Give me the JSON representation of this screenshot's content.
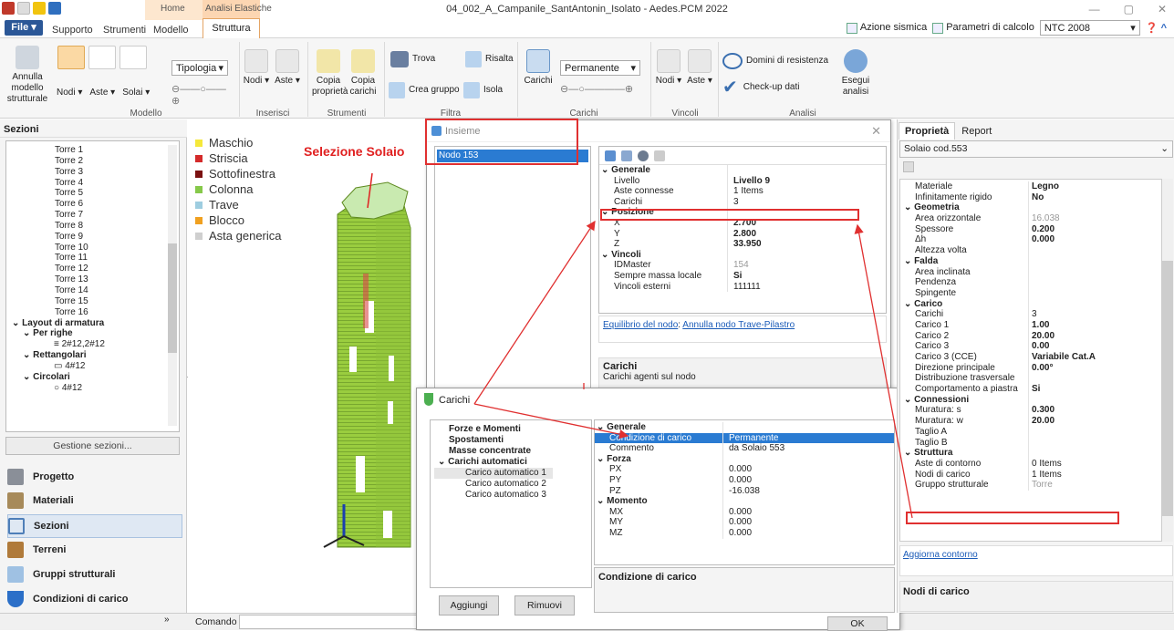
{
  "window": {
    "title": "04_002_A_Campanile_SantAntonin_Isolato - Aedes.PCM 2022"
  },
  "menu": {
    "file": "File",
    "tabs": [
      "Supporto",
      "Strumenti",
      "Modello"
    ],
    "context_home": "Home",
    "context_analisi": "Analisi Elastiche",
    "struttura": "Struttura",
    "azione_sismica": "Azione sismica",
    "parametri_calcolo": "Parametri di calcolo",
    "ntc": "NTC 2008"
  },
  "ribbon": {
    "annulla_modello": "Annulla modello strutturale",
    "nodi": "Nodi",
    "aste": "Aste",
    "solai": "Solai",
    "tipologia": "Tipologia",
    "group_modello": "Modello",
    "ins_nodi": "Nodi",
    "ins_aste": "Aste",
    "group_inserisci": "Inserisci",
    "copia_proprieta": "Copia proprietà",
    "copia_carichi": "Copia carichi",
    "group_strumenti": "Strumenti",
    "trova": "Trova",
    "risalta": "Risalta",
    "crea_gruppo": "Crea gruppo",
    "isola": "Isola",
    "group_filtra": "Filtra",
    "carichi": "Carichi",
    "permanente": "Permanente",
    "group_carichi": "Carichi",
    "vin_nodi": "Nodi",
    "vin_aste": "Aste",
    "group_vincoli": "Vincoli",
    "domini": "Domini di resistenza",
    "checkup": "Check-up dati",
    "esegui": "Esegui analisi",
    "group_analisi": "Analisi"
  },
  "left": {
    "header": "Sezioni",
    "torri": [
      "Torre 1",
      "Torre 2",
      "Torre 3",
      "Torre 4",
      "Torre 5",
      "Torre 6",
      "Torre 7",
      "Torre 8",
      "Torre 9",
      "Torre 10",
      "Torre 11",
      "Torre 12",
      "Torre 13",
      "Torre 14",
      "Torre 15",
      "Torre 16"
    ],
    "layout": "Layout di armatura",
    "per_righe": "Per righe",
    "per_righe_val": "≡ 2#12,2#12",
    "rettangolari": "Rettangolari",
    "rett_val": "▭ 4#12",
    "circolari": "Circolari",
    "circ_val": "○ 4#12",
    "gestione": "Gestione sezioni...",
    "nav": [
      "Progetto",
      "Materiali",
      "Sezioni",
      "Terreni",
      "Gruppi strutturali",
      "Condizioni di carico"
    ]
  },
  "command": {
    "label": "Comando"
  },
  "legend": [
    {
      "label": "Maschio",
      "color": "#f5e83a"
    },
    {
      "label": "Striscia",
      "color": "#d42a2a"
    },
    {
      "label": "Sottofinestra",
      "color": "#7a1010"
    },
    {
      "label": "Colonna",
      "color": "#86c94a"
    },
    {
      "label": "Trave",
      "color": "#9ecde0"
    },
    {
      "label": "Blocco",
      "color": "#f0a020"
    },
    {
      "label": "Asta generica",
      "color": "#cfcfcf"
    }
  ],
  "annotation": "Selezione Solaio",
  "insieme": {
    "title": "Insieme",
    "nodo": "Nodo 153",
    "rows": [
      {
        "k": "Generale",
        "cat": true
      },
      {
        "k": "Livello",
        "v": "Livello 9",
        "b": true
      },
      {
        "k": "Aste connesse",
        "v": "1 Items"
      },
      {
        "k": "Carichi",
        "v": "3"
      },
      {
        "k": "Posizione",
        "cat": true
      },
      {
        "k": "X",
        "v": "2.700",
        "b": true
      },
      {
        "k": "Y",
        "v": "2.800",
        "b": true
      },
      {
        "k": "Z",
        "v": "33.950",
        "b": true
      },
      {
        "k": "Vincoli",
        "cat": true
      },
      {
        "k": "IDMaster",
        "v": "154",
        "g": true
      },
      {
        "k": "Sempre massa locale",
        "v": "Si",
        "b": true
      },
      {
        "k": "Vincoli esterni",
        "v": "111111"
      }
    ],
    "link1": "Equilibrio del nodo",
    "link2": "Annulla nodo Trave-Pilastro",
    "desc_title": "Carichi",
    "desc_text": "Carichi agenti sul nodo"
  },
  "carichi": {
    "title": "Carichi",
    "tree": [
      "Forze e Momenti",
      "Spostamenti",
      "Masse concentrate",
      "Carichi automatici",
      "Carico automatico 1",
      "Carico automatico 2",
      "Carico automatico 3"
    ],
    "rows": [
      {
        "k": "Generale",
        "cat": true
      },
      {
        "k": "Condizione di carico",
        "v": "Permanente",
        "sel": true
      },
      {
        "k": "Commento",
        "v": "da Solaio 553"
      },
      {
        "k": "Forza",
        "cat": true
      },
      {
        "k": "PX",
        "v": "0.000"
      },
      {
        "k": "PY",
        "v": "0.000"
      },
      {
        "k": "PZ",
        "v": "-16.038"
      },
      {
        "k": "Momento",
        "cat": true
      },
      {
        "k": "MX",
        "v": "0.000"
      },
      {
        "k": "MY",
        "v": "0.000"
      },
      {
        "k": "MZ",
        "v": "0.000"
      }
    ],
    "desc": "Condizione di carico",
    "aggiungi": "Aggiungi",
    "rimuovi": "Rimuovi",
    "ok": "OK"
  },
  "right": {
    "tab_prop": "Proprietà",
    "tab_report": "Report",
    "selected": "Solaio cod.553",
    "rows": [
      {
        "k": "Materiale",
        "v": "Legno",
        "b": true
      },
      {
        "k": "Infinitamente rigido",
        "v": "No",
        "b": true
      },
      {
        "k": "Geometria",
        "cat": true
      },
      {
        "k": "Area orizzontale",
        "v": "16.038",
        "g": true
      },
      {
        "k": "Spessore",
        "v": "0.200",
        "b": true
      },
      {
        "k": "Δh",
        "v": "0.000",
        "b": true
      },
      {
        "k": "Altezza volta",
        "v": ""
      },
      {
        "k": "Falda",
        "cat": true
      },
      {
        "k": "Area inclinata",
        "v": "",
        "g": true
      },
      {
        "k": "Pendenza",
        "v": ""
      },
      {
        "k": "Spingente",
        "v": ""
      },
      {
        "k": "Carico",
        "cat": true
      },
      {
        "k": "Carichi",
        "v": "3"
      },
      {
        "k": "Carico 1",
        "v": "1.00",
        "b": true
      },
      {
        "k": "Carico 2",
        "v": "20.00",
        "b": true
      },
      {
        "k": "Carico 3",
        "v": "0.00",
        "b": true
      },
      {
        "k": "Carico 3 (CCE)",
        "v": "Variabile Cat.A",
        "b": true
      },
      {
        "k": "Direzione principale",
        "v": "0.00°",
        "b": true
      },
      {
        "k": "Distribuzione trasversale",
        "v": ""
      },
      {
        "k": "Comportamento a piastra",
        "v": "Si",
        "b": true
      },
      {
        "k": "Connessioni",
        "cat": true
      },
      {
        "k": "Muratura: s",
        "v": "0.300",
        "b": true
      },
      {
        "k": "Muratura: w",
        "v": "20.00",
        "b": true
      },
      {
        "k": "Taglio A",
        "v": "",
        "g": true
      },
      {
        "k": "Taglio B",
        "v": "",
        "g": true
      },
      {
        "k": "Struttura",
        "cat": true
      },
      {
        "k": "Aste di contorno",
        "v": "0 Items"
      },
      {
        "k": "Nodi di carico",
        "v": "1 Items"
      },
      {
        "k": "Gruppo strutturale",
        "v": "Torre",
        "g": true
      }
    ],
    "aggiorna": "Aggiorna contorno",
    "desc_title": "Nodi di carico"
  }
}
